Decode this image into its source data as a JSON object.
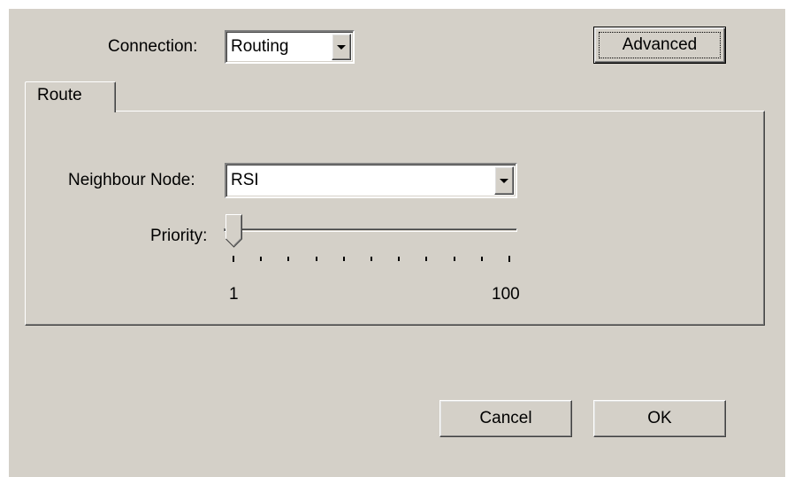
{
  "connection": {
    "label": "Connection:",
    "value": "Routing"
  },
  "buttons": {
    "advanced": "Advanced",
    "cancel": "Cancel",
    "ok": "OK"
  },
  "tabs": [
    {
      "label": "Route",
      "active": true
    }
  ],
  "route": {
    "neighbour_label": "Neighbour Node:",
    "neighbour_value": "RSI",
    "priority_label": "Priority:",
    "priority_min": "1",
    "priority_max": "100",
    "priority_value": 1,
    "priority_tick_count": 11
  },
  "colors": {
    "dialog_bg": "#d4d0c8",
    "field_bg": "#ffffff"
  }
}
